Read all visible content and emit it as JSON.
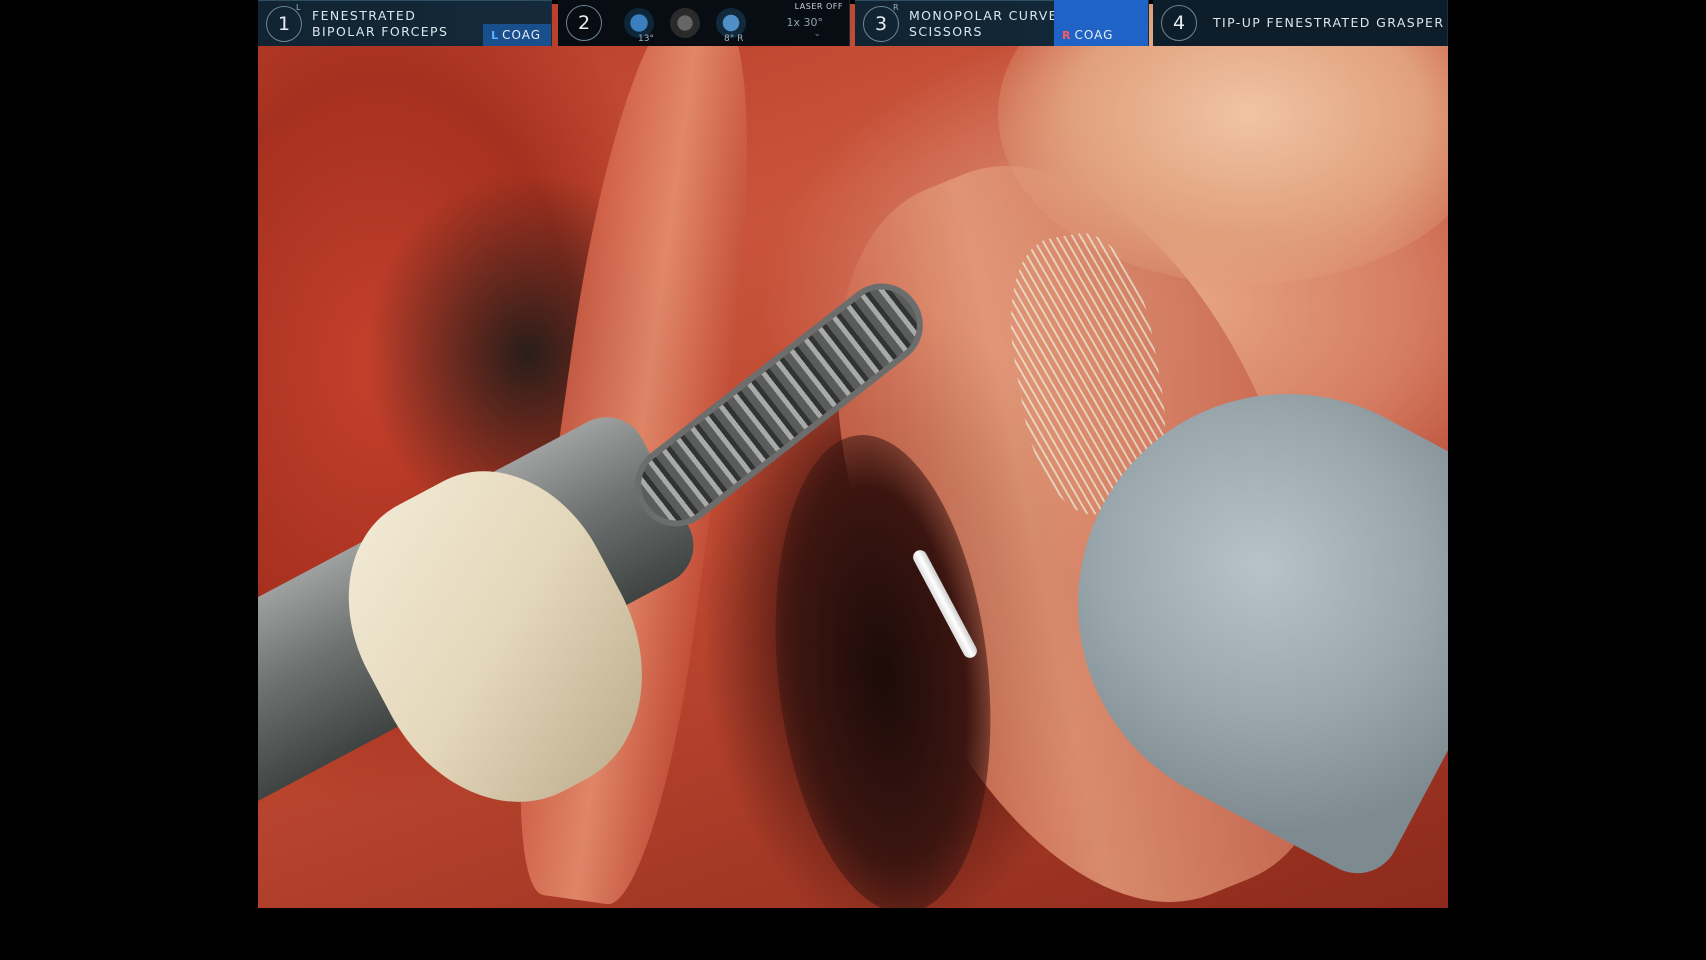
{
  "hud": {
    "arm1": {
      "number": "1",
      "sub": "L",
      "name_line1": "FENESTRATED",
      "name_line2": "BIPOLAR FORCEPS",
      "energy_side": "L",
      "energy_mode": "COAG"
    },
    "camera": {
      "number": "2",
      "angle_left": "13°",
      "angle_right": "8° R",
      "laser": "LASER OFF",
      "scope": "1x 30°",
      "chevron": "⌄"
    },
    "arm3": {
      "number": "3",
      "sub": "R",
      "name_line1": "MONOPOLAR CURVED",
      "name_line2": "SCISSORS",
      "energy_side": "R",
      "energy_mode": "COAG"
    },
    "arm4": {
      "number": "4",
      "name": "TIP-UP FENESTRATED GRASPER"
    }
  },
  "icons": {
    "camera_left": "camera-tilt-icon",
    "camera_center": "camera-view-icon",
    "camera_right": "camera-rotate-icon"
  },
  "colors": {
    "hud_bg": "#0b1a26",
    "energy_blue": "#1f63c7",
    "accent_text": "#dbe6ee"
  }
}
